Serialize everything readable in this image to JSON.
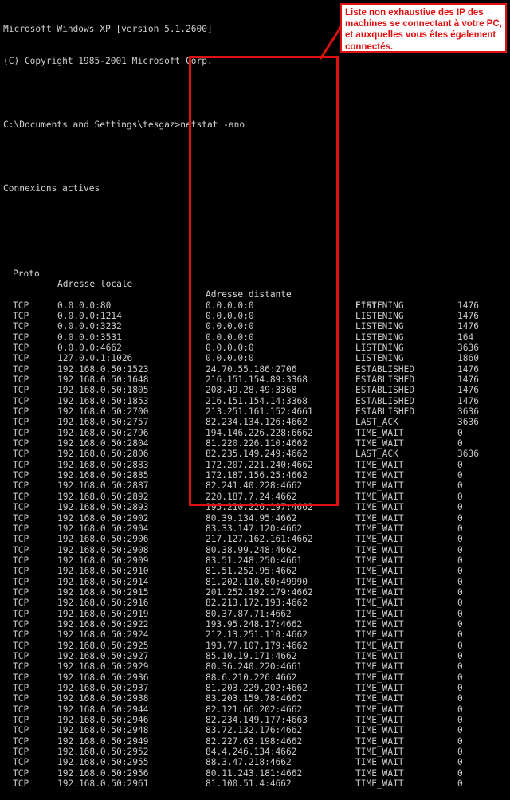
{
  "console": {
    "banner_line1": "Microsoft Windows XP [version 5.1.2600]",
    "banner_line2": "(C) Copyright 1985-2001 Microsoft Corp.",
    "prompt_line": "C:\\Documents and Settings\\tesgaz>netstat -ano",
    "section_title": "Connexions actives",
    "headers": {
      "proto": "Proto",
      "local": "Adresse locale",
      "remote": "Adresse distante",
      "state": "Etat",
      "pid": ""
    }
  },
  "annotation": {
    "text": "Liste non exhaustive des IP des machines se connectant à votre PC, et auxquelles vous êtes également connectés.",
    "border_color": "#e01010",
    "text_color": "#e01010",
    "background_color": "#ffffff"
  },
  "highlight_box": {
    "target_column": "Adresse distante",
    "color": "#e01010"
  },
  "connections": [
    {
      "proto": "TCP",
      "local": "0.0.0.0:80",
      "remote": "0.0.0.0:0",
      "state": "LISTENING",
      "pid": "1476"
    },
    {
      "proto": "TCP",
      "local": "0.0.0.0:1214",
      "remote": "0.0.0.0:0",
      "state": "LISTENING",
      "pid": "1476"
    },
    {
      "proto": "TCP",
      "local": "0.0.0.0:3232",
      "remote": "0.0.0.0:0",
      "state": "LISTENING",
      "pid": "1476"
    },
    {
      "proto": "TCP",
      "local": "0.0.0.0:3531",
      "remote": "0.0.0.0:0",
      "state": "LISTENING",
      "pid": "164"
    },
    {
      "proto": "TCP",
      "local": "0.0.0.0:4662",
      "remote": "0.0.0.0:0",
      "state": "LISTENING",
      "pid": "3636"
    },
    {
      "proto": "TCP",
      "local": "127.0.0.1:1026",
      "remote": "0.0.0.0:0",
      "state": "LISTENING",
      "pid": "1860"
    },
    {
      "proto": "TCP",
      "local": "192.168.0.50:1523",
      "remote": "24.70.55.186:2706",
      "state": "ESTABLISHED",
      "pid": "1476"
    },
    {
      "proto": "TCP",
      "local": "192.168.0.50:1648",
      "remote": "216.151.154.89:3368",
      "state": "ESTABLISHED",
      "pid": "1476"
    },
    {
      "proto": "TCP",
      "local": "192.168.0.50:1805",
      "remote": "208.49.28.49:3368",
      "state": "ESTABLISHED",
      "pid": "1476"
    },
    {
      "proto": "TCP",
      "local": "192.168.0.50:1853",
      "remote": "216.151.154.14:3368",
      "state": "ESTABLISHED",
      "pid": "1476"
    },
    {
      "proto": "TCP",
      "local": "192.168.0.50:2700",
      "remote": "213.251.161.152:4661",
      "state": "ESTABLISHED",
      "pid": "3636"
    },
    {
      "proto": "TCP",
      "local": "192.168.0.50:2757",
      "remote": "82.234.134.126:4662",
      "state": "LAST_ACK",
      "pid": "3636"
    },
    {
      "proto": "TCP",
      "local": "192.168.0.50:2796",
      "remote": "194.146.226.228:6662",
      "state": "TIME_WAIT",
      "pid": "0"
    },
    {
      "proto": "TCP",
      "local": "192.168.0.50:2804",
      "remote": "81.220.226.110:4662",
      "state": "TIME_WAIT",
      "pid": "0"
    },
    {
      "proto": "TCP",
      "local": "192.168.0.50:2806",
      "remote": "82.235.149.249:4662",
      "state": "LAST_ACK",
      "pid": "3636"
    },
    {
      "proto": "TCP",
      "local": "192.168.0.50:2883",
      "remote": "172.207.221.240:4662",
      "state": "TIME_WAIT",
      "pid": "0"
    },
    {
      "proto": "TCP",
      "local": "192.168.0.50:2885",
      "remote": "172.187.156.25:4662",
      "state": "TIME_WAIT",
      "pid": "0"
    },
    {
      "proto": "TCP",
      "local": "192.168.0.50:2887",
      "remote": "82.241.40.228:4662",
      "state": "TIME_WAIT",
      "pid": "0"
    },
    {
      "proto": "TCP",
      "local": "192.168.0.50:2892",
      "remote": "220.187.7.24:4662",
      "state": "TIME_WAIT",
      "pid": "0"
    },
    {
      "proto": "TCP",
      "local": "192.168.0.50:2893",
      "remote": "195.210.226.197:4662",
      "state": "TIME_WAIT",
      "pid": "0"
    },
    {
      "proto": "TCP",
      "local": "192.168.0.50:2902",
      "remote": "80.39.134.95:4662",
      "state": "TIME_WAIT",
      "pid": "0"
    },
    {
      "proto": "TCP",
      "local": "192.168.0.50:2904",
      "remote": "83.33.147.120:4662",
      "state": "TIME_WAIT",
      "pid": "0"
    },
    {
      "proto": "TCP",
      "local": "192.168.0.50:2906",
      "remote": "217.127.162.161:4662",
      "state": "TIME_WAIT",
      "pid": "0"
    },
    {
      "proto": "TCP",
      "local": "192.168.0.50:2908",
      "remote": "80.38.99.248:4662",
      "state": "TIME_WAIT",
      "pid": "0"
    },
    {
      "proto": "TCP",
      "local": "192.168.0.50:2909",
      "remote": "83.51.248.250:4661",
      "state": "TIME_WAIT",
      "pid": "0"
    },
    {
      "proto": "TCP",
      "local": "192.168.0.50:2910",
      "remote": "81.51.252.95:4662",
      "state": "TIME_WAIT",
      "pid": "0"
    },
    {
      "proto": "TCP",
      "local": "192.168.0.50:2914",
      "remote": "81.202.110.80:49990",
      "state": "TIME_WAIT",
      "pid": "0"
    },
    {
      "proto": "TCP",
      "local": "192.168.0.50:2915",
      "remote": "201.252.192.179:4662",
      "state": "TIME_WAIT",
      "pid": "0"
    },
    {
      "proto": "TCP",
      "local": "192.168.0.50:2916",
      "remote": "82.213.172.193:4662",
      "state": "TIME_WAIT",
      "pid": "0"
    },
    {
      "proto": "TCP",
      "local": "192.168.0.50:2919",
      "remote": "80.37.87.71:4662",
      "state": "TIME_WAIT",
      "pid": "0"
    },
    {
      "proto": "TCP",
      "local": "192.168.0.50:2922",
      "remote": "193.95.248.17:4662",
      "state": "TIME_WAIT",
      "pid": "0"
    },
    {
      "proto": "TCP",
      "local": "192.168.0.50:2924",
      "remote": "212.13.251.110:4662",
      "state": "TIME_WAIT",
      "pid": "0"
    },
    {
      "proto": "TCP",
      "local": "192.168.0.50:2925",
      "remote": "193.77.107.179:4662",
      "state": "TIME_WAIT",
      "pid": "0"
    },
    {
      "proto": "TCP",
      "local": "192.168.0.50:2927",
      "remote": "85.10.19.171:4662",
      "state": "TIME_WAIT",
      "pid": "0"
    },
    {
      "proto": "TCP",
      "local": "192.168.0.50:2929",
      "remote": "80.36.240.220:4661",
      "state": "TIME_WAIT",
      "pid": "0"
    },
    {
      "proto": "TCP",
      "local": "192.168.0.50:2936",
      "remote": "88.6.210.226:4662",
      "state": "TIME_WAIT",
      "pid": "0"
    },
    {
      "proto": "TCP",
      "local": "192.168.0.50:2937",
      "remote": "81.203.229.202:4662",
      "state": "TIME_WAIT",
      "pid": "0"
    },
    {
      "proto": "TCP",
      "local": "192.168.0.50:2938",
      "remote": "83.203.159.78:4662",
      "state": "TIME_WAIT",
      "pid": "0"
    },
    {
      "proto": "TCP",
      "local": "192.168.0.50:2944",
      "remote": "82.121.66.202:4662",
      "state": "TIME_WAIT",
      "pid": "0"
    },
    {
      "proto": "TCP",
      "local": "192.168.0.50:2946",
      "remote": "82.234.149.177:4663",
      "state": "TIME_WAIT",
      "pid": "0"
    },
    {
      "proto": "TCP",
      "local": "192.168.0.50:2948",
      "remote": "83.72.132.176:4662",
      "state": "TIME_WAIT",
      "pid": "0"
    },
    {
      "proto": "TCP",
      "local": "192.168.0.50:2949",
      "remote": "82.227.63.198:4662",
      "state": "TIME_WAIT",
      "pid": "0"
    },
    {
      "proto": "TCP",
      "local": "192.168.0.50:2952",
      "remote": "84.4.246.134:4662",
      "state": "TIME_WAIT",
      "pid": "0"
    },
    {
      "proto": "TCP",
      "local": "192.168.0.50:2955",
      "remote": "88.3.47.218:4662",
      "state": "TIME_WAIT",
      "pid": "0"
    },
    {
      "proto": "TCP",
      "local": "192.168.0.50:2956",
      "remote": "80.11.243.181:4662",
      "state": "TIME_WAIT",
      "pid": "0"
    },
    {
      "proto": "TCP",
      "local": "192.168.0.50:2961",
      "remote": "81.100.51.4:4662",
      "state": "TIME_WAIT",
      "pid": "0"
    }
  ]
}
